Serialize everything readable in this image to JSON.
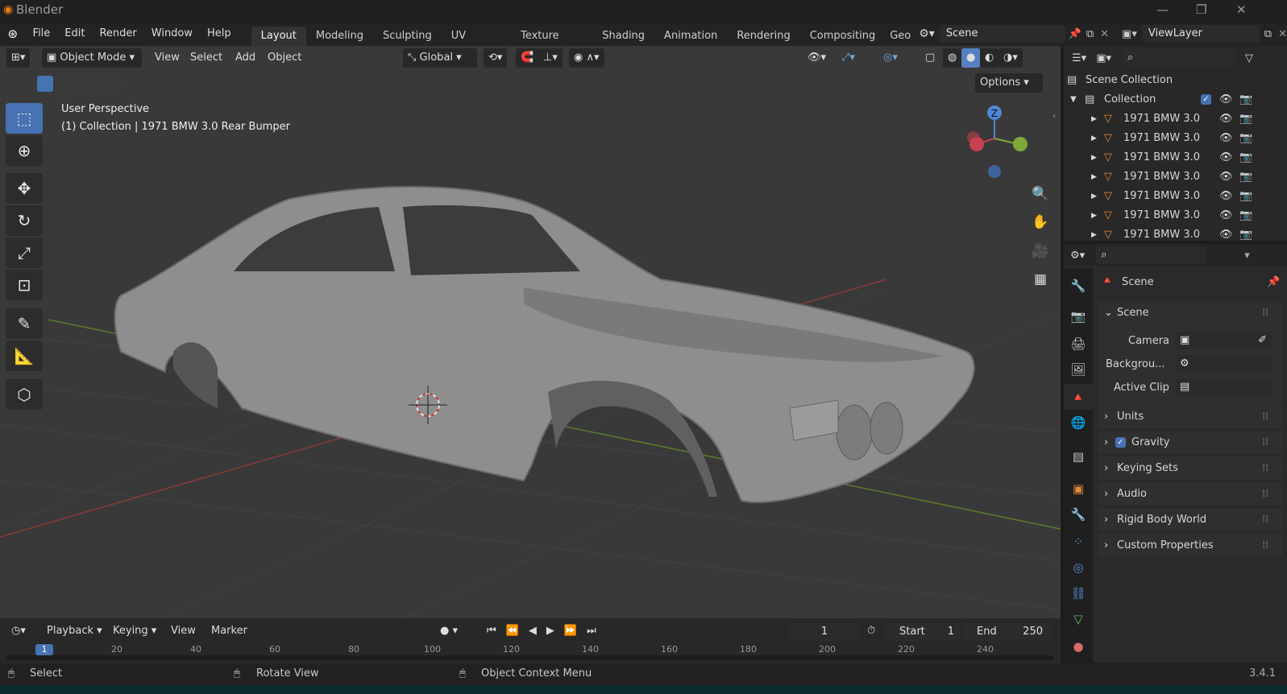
{
  "window": {
    "app_title": "Blender",
    "minimize": "—",
    "maximize": "❐",
    "close": "✕"
  },
  "menu": [
    "File",
    "Edit",
    "Render",
    "Window",
    "Help"
  ],
  "workspaces": [
    "Layout",
    "Modeling",
    "Sculpting",
    "UV Editing",
    "Texture Paint",
    "Shading",
    "Animation",
    "Rendering",
    "Compositing",
    "Geo"
  ],
  "active_workspace": "Layout",
  "scene_field": "Scene",
  "viewlayer_field": "ViewLayer",
  "viewport": {
    "mode": "Object Mode",
    "menus": [
      "View",
      "Select",
      "Add",
      "Object"
    ],
    "transform": "Global",
    "options": "Options",
    "info_line1": "User Perspective",
    "info_line2": "(1) Collection | 1971 BMW 3.0 Rear Bumper",
    "gizmo": {
      "z": "Z"
    },
    "accent": "#4772b3"
  },
  "outliner": {
    "root": "Scene Collection",
    "collection": "Collection",
    "items": [
      "1971 BMW 3.0",
      "1971 BMW 3.0",
      "1971 BMW 3.0",
      "1971 BMW 3.0",
      "1971 BMW 3.0",
      "1971 BMW 3.0",
      "1971 BMW 3.0"
    ]
  },
  "properties": {
    "context": "Scene",
    "section": "Scene",
    "camera_label": "Camera",
    "background_label": "Backgrou...",
    "active_clip_label": "Active Clip",
    "panels": [
      "Units",
      "Gravity",
      "Keying Sets",
      "Audio",
      "Rigid Body World",
      "Custom Properties"
    ]
  },
  "timeline": {
    "menus": [
      "Playback",
      "Keying",
      "View",
      "Marker"
    ],
    "current_frame": "1",
    "start_label": "Start",
    "start": "1",
    "end_label": "End",
    "end": "250",
    "ruler": [
      "1",
      "20",
      "40",
      "60",
      "80",
      "100",
      "120",
      "140",
      "160",
      "180",
      "200",
      "220",
      "240"
    ]
  },
  "status": {
    "select": "Select",
    "rotate": "Rotate View",
    "context_menu": "Object Context Menu",
    "version": "3.4.1"
  }
}
